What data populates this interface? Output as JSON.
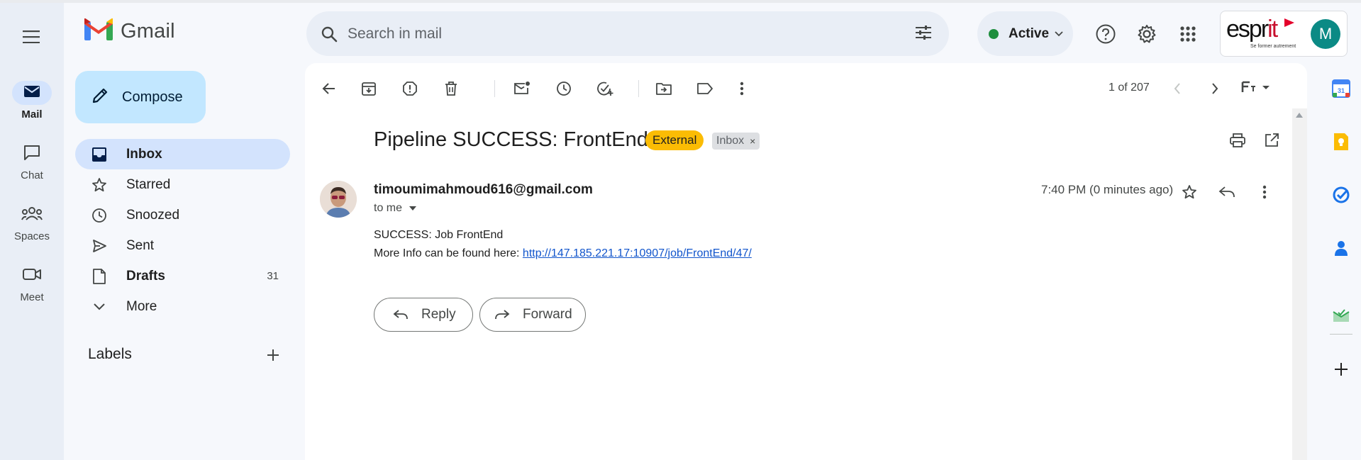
{
  "app": {
    "name": "Gmail"
  },
  "rail": {
    "items": [
      {
        "label": "Mail",
        "icon": "mail-icon",
        "active": true
      },
      {
        "label": "Chat",
        "icon": "chat-icon"
      },
      {
        "label": "Spaces",
        "icon": "spaces-icon"
      },
      {
        "label": "Meet",
        "icon": "meet-icon"
      }
    ]
  },
  "search": {
    "placeholder": "Search in mail"
  },
  "status": {
    "label": "Active",
    "color": "#1e8e3e"
  },
  "account": {
    "org_logo": "esprit",
    "org_tagline": "Se former autrement",
    "avatar_letter": "M",
    "avatar_color": "#0b8a85"
  },
  "sidebar": {
    "compose_label": "Compose",
    "items": [
      {
        "label": "Inbox",
        "icon": "inbox-icon",
        "selected": true,
        "bold": true,
        "count": ""
      },
      {
        "label": "Starred",
        "icon": "star-icon",
        "count": ""
      },
      {
        "label": "Snoozed",
        "icon": "clock-icon",
        "count": ""
      },
      {
        "label": "Sent",
        "icon": "send-icon",
        "count": ""
      },
      {
        "label": "Drafts",
        "icon": "draft-icon",
        "bold": true,
        "count": "31"
      },
      {
        "label": "More",
        "icon": "chevron-down-icon",
        "count": ""
      }
    ],
    "labels_heading": "Labels"
  },
  "toolbar": {
    "pager": "1 of 207"
  },
  "message": {
    "subject": "Pipeline SUCCESS: FrontEnd",
    "tags": {
      "external": "External",
      "inbox": "Inbox",
      "inbox_remove": "×"
    },
    "sender": "timoumimahmoud616@gmail.com",
    "recipient": "to me",
    "time": "7:40 PM (0 minutes ago)",
    "body_line1": "SUCCESS: Job FrontEnd",
    "body_line2_prefix": "More Info can be found here: ",
    "body_link": "http://147.185.221.17:10907/job/FrontEnd/47/"
  },
  "actions": {
    "reply": "Reply",
    "forward": "Forward"
  },
  "colors": {
    "accent": "#0b57d0",
    "compose_bg": "#c2e7ff",
    "selected_bg": "#d3e3fd",
    "external_tag": "#fbbc04"
  }
}
